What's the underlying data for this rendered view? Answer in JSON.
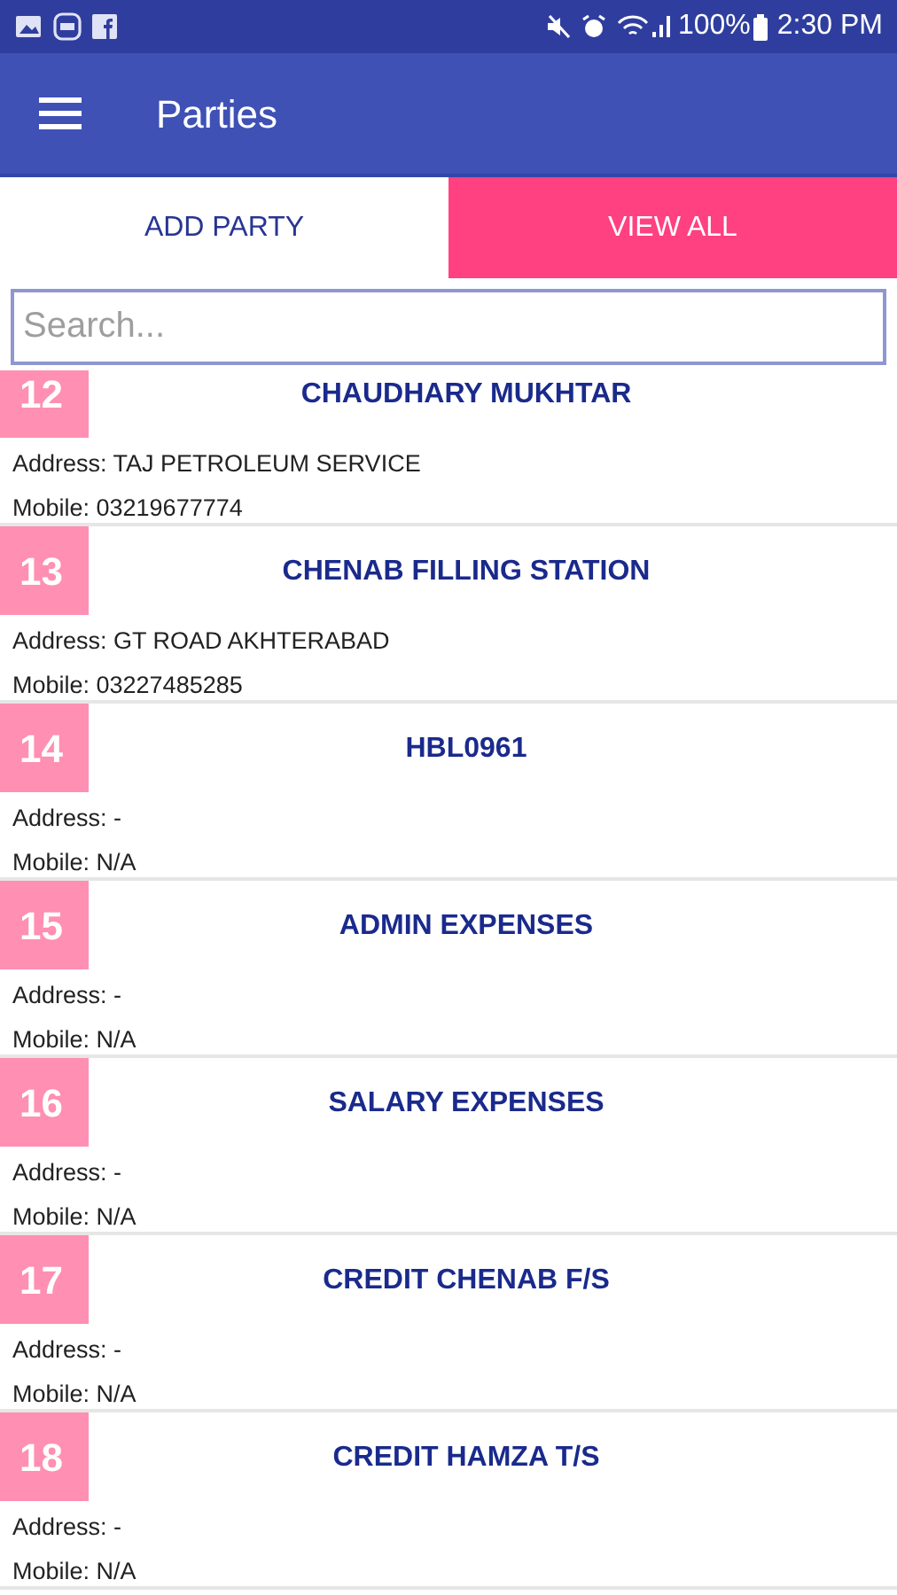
{
  "status_bar": {
    "battery": "100%",
    "time": "2:30 PM"
  },
  "app_bar": {
    "title": "Parties"
  },
  "tabs": [
    {
      "label": "ADD PARTY",
      "selected": false
    },
    {
      "label": "VIEW ALL",
      "selected": true
    }
  ],
  "search": {
    "placeholder": "Search..."
  },
  "parties": [
    {
      "number": "12",
      "name": "CHAUDHARY MUKHTAR",
      "address": "Address: TAJ PETROLEUM SERVICE",
      "mobile": "Mobile: 03219677774"
    },
    {
      "number": "13",
      "name": "CHENAB FILLING STATION",
      "address": "Address: GT ROAD AKHTERABAD",
      "mobile": "Mobile: 03227485285"
    },
    {
      "number": "14",
      "name": "HBL0961",
      "address": "Address: -",
      "mobile": "Mobile: N/A"
    },
    {
      "number": "15",
      "name": "ADMIN EXPENSES",
      "address": "Address: -",
      "mobile": "Mobile: N/A"
    },
    {
      "number": "16",
      "name": "SALARY EXPENSES",
      "address": "Address: -",
      "mobile": "Mobile: N/A"
    },
    {
      "number": "17",
      "name": "CREDIT CHENAB F/S",
      "address": "Address: -",
      "mobile": "Mobile: N/A"
    },
    {
      "number": "18",
      "name": "CREDIT HAMZA T/S",
      "address": "Address: -",
      "mobile": "Mobile: N/A"
    }
  ]
}
